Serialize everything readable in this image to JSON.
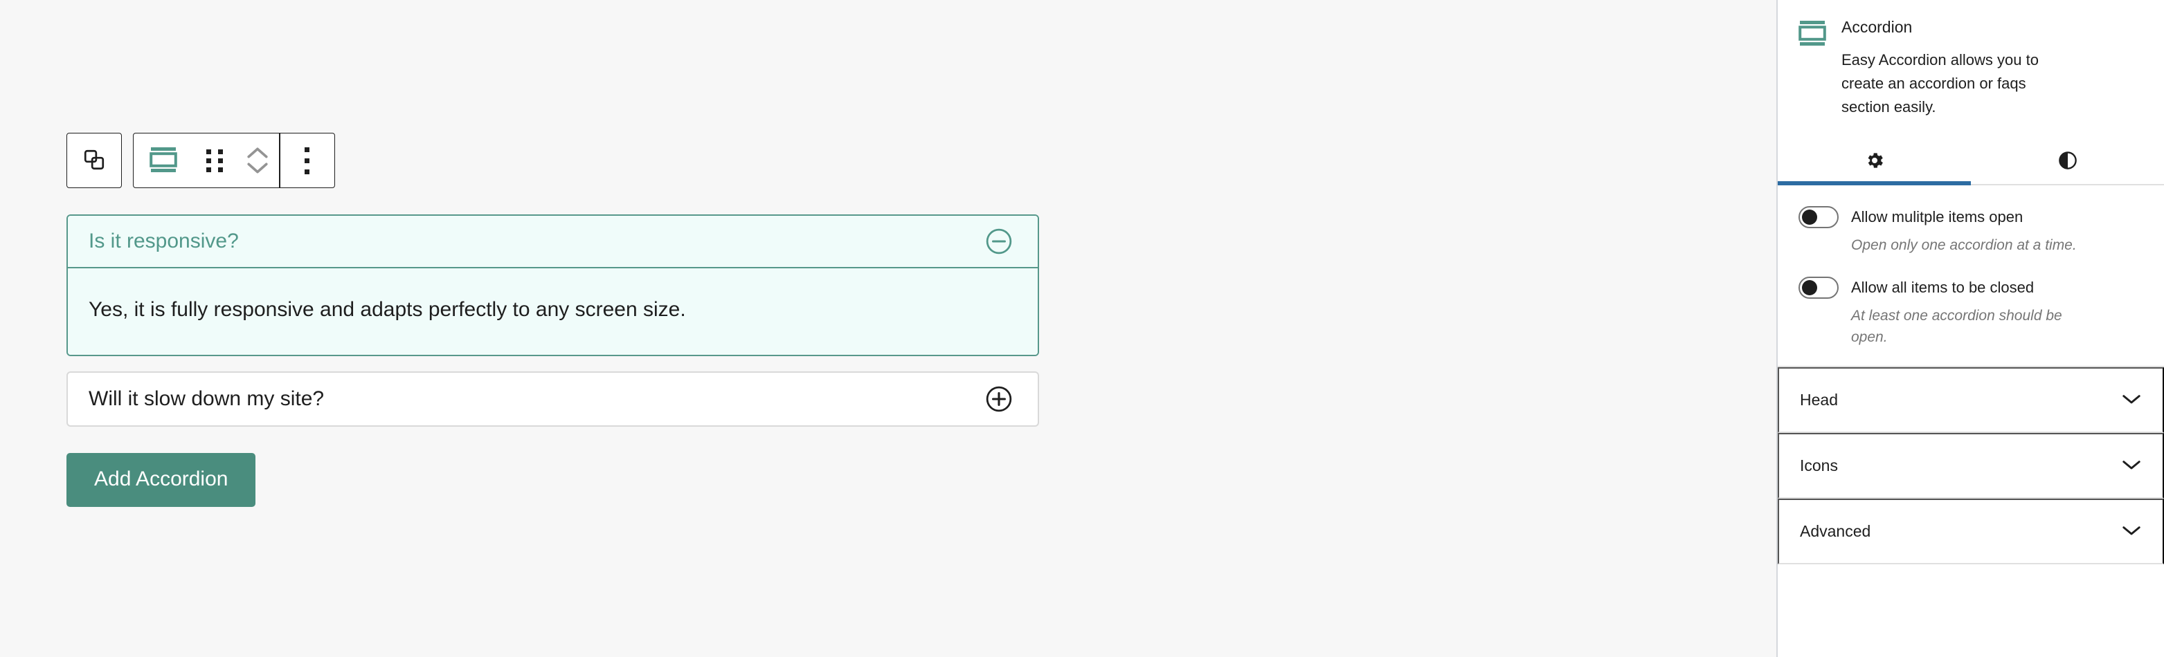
{
  "editor": {
    "toolbar": {
      "select_parent_label": "select-parent-block",
      "block_type_label": "accordion-block",
      "drag_label": "drag",
      "move_up_label": "move-up",
      "move_down_label": "move-down",
      "more_options_label": "options"
    },
    "accordion": {
      "items": [
        {
          "title": "Is it responsive?",
          "content": "Yes, it is fully responsive and adapts perfectly to any screen size.",
          "open": true,
          "toggle_icon": "circle-minus-icon"
        },
        {
          "title": "Will it slow down my site?",
          "content": "",
          "open": false,
          "toggle_icon": "circle-plus-icon"
        }
      ],
      "add_button_label": "Add Accordion"
    }
  },
  "sidebar": {
    "block": {
      "icon": "accordion-icon",
      "name": "Accordion",
      "description": "Easy Accordion allows you to create an accordion or faqs section easily."
    },
    "tabs": [
      {
        "icon": "gear-icon",
        "name": "settings",
        "active": true
      },
      {
        "icon": "contrast-icon",
        "name": "styles",
        "active": false
      }
    ],
    "settings": [
      {
        "label": "Allow mulitple items open",
        "help": "Open only one accordion at a time.",
        "enabled": false
      },
      {
        "label": "Allow all items to be closed",
        "help": "At least one accordion should be open.",
        "enabled": false
      }
    ],
    "panels": [
      {
        "title": "Head",
        "icon": "chevron-down-icon"
      },
      {
        "title": "Icons",
        "icon": "chevron-down-icon"
      },
      {
        "title": "Advanced",
        "icon": "chevron-down-icon"
      }
    ]
  },
  "colors": {
    "accent_green": "#4a8d7e",
    "accent_green_border": "#57988b",
    "accent_green_text": "#52988a",
    "tint_background": "#f0fcfa",
    "tab_active": "#2d6ca2",
    "canvas": "#f7f7f7"
  }
}
